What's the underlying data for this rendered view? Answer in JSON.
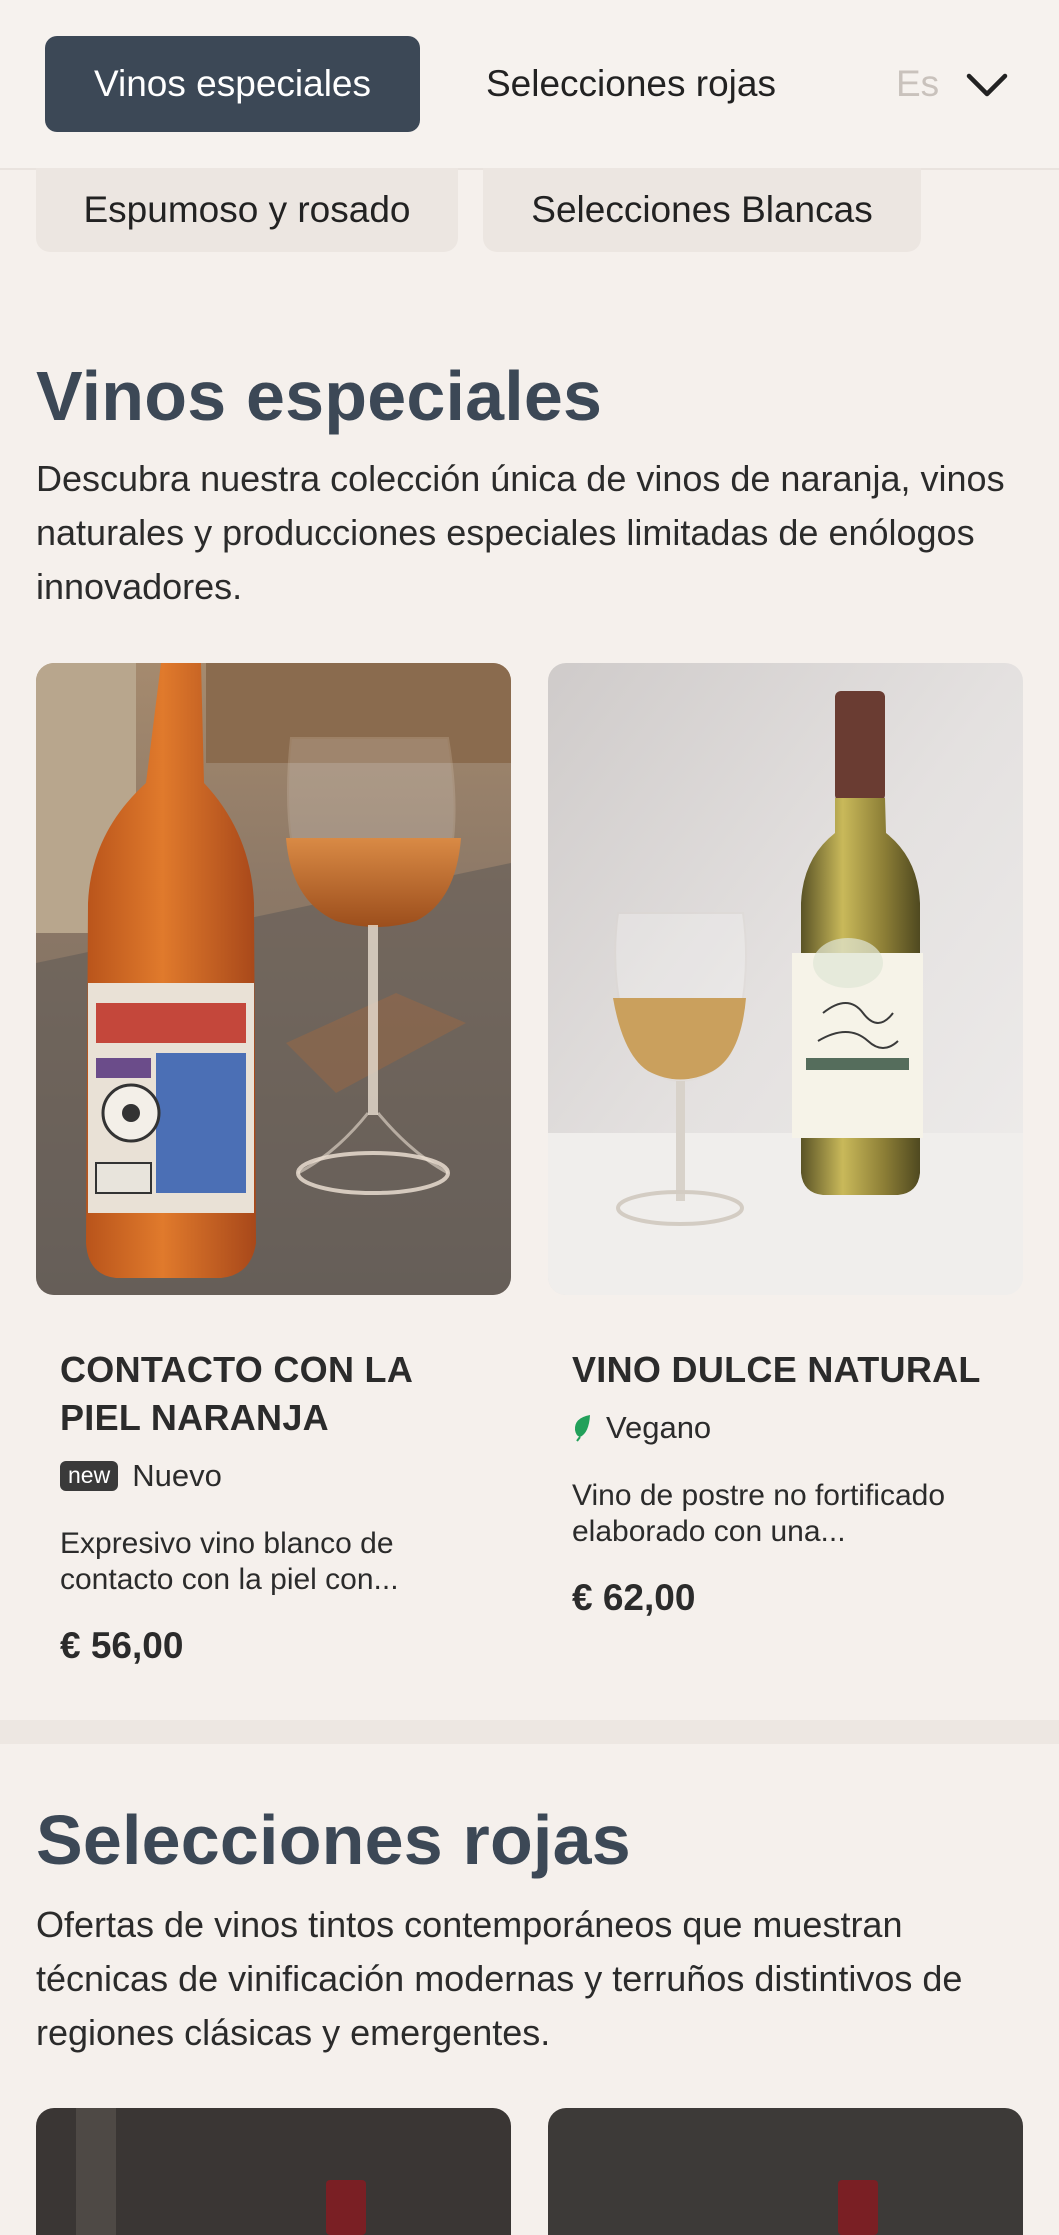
{
  "tabs": {
    "active": "Vinos especiales",
    "second": "Selecciones rojas",
    "third_partial": "Es"
  },
  "chips": [
    "Espumoso y rosado",
    "Selecciones Blancas"
  ],
  "sections": [
    {
      "title": "Vinos especiales",
      "description": "Descubra nuestra colección única de vinos de naranja, vinos naturales y producciones especiales limitadas de enólogos innovadores.",
      "products": [
        {
          "name": "CONTACTO CON LA PIEL NARANJA",
          "badge": "new",
          "badge_label": "Nuevo",
          "description": "Expresivo vino blanco de contacto con la piel con...",
          "price": "€ 56,00"
        },
        {
          "name": "VINO DULCE NATURAL",
          "badge_icon": "leaf-icon",
          "badge_label": "Vegano",
          "description": "Vino de postre no fortificado elaborado con una...",
          "price": "€ 62,00"
        }
      ]
    },
    {
      "title": "Selecciones rojas",
      "description": "Ofertas de vinos tintos contemporáneos que muestran técnicas de vinificación modernas y terruños distintivos de regiones clásicas y emergentes."
    }
  ],
  "colors": {
    "accent": "#3c4856",
    "background": "#f5f0ec",
    "vegan_leaf": "#22a05a"
  }
}
